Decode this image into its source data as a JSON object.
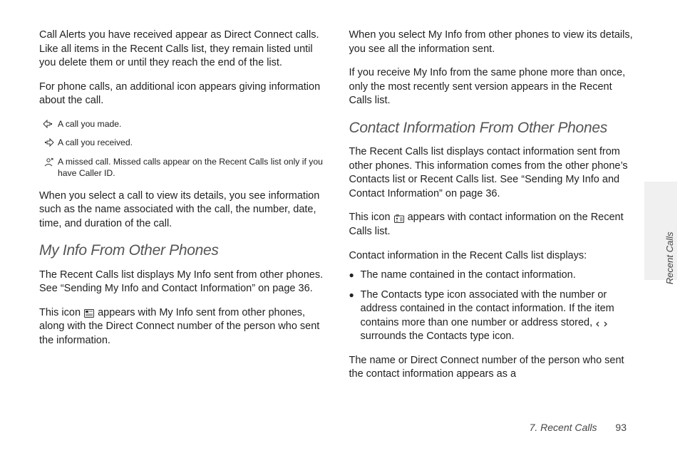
{
  "left": {
    "p1": "Call Alerts you have received appear as Direct Connect calls. Like all items in the Recent Calls list, they remain listed until you delete them or until they reach the end of the list.",
    "p2": "For phone calls, an additional icon appears giving information about the call.",
    "icons": [
      {
        "label": "A call you made."
      },
      {
        "label": "A call you received."
      },
      {
        "label": "A missed call. Missed calls appear on the Recent Calls list only if you have Caller ID."
      }
    ],
    "p3": "When you select a call to view its details, you see information such as the name associated with the call, the number, date, time, and duration of the call.",
    "h1": "My Info From Other Phones",
    "p4": "The Recent Calls list displays My Info sent from other phones. See “Sending My Info and Contact Information” on page 36.",
    "p5a": "This icon ",
    "p5b": " appears with My Info sent from other phones, along with the Direct Connect number of the person who sent the information."
  },
  "right": {
    "p1": "When you select My Info from other phones to view its details, you see all the information sent.",
    "p2": "If you receive My Info from the same phone more than once, only the most recently sent version appears in the Recent Calls list.",
    "h1": "Contact Information From Other Phones",
    "p3": "The Recent Calls list displays contact information sent from other phones. This information comes from the other phone’s Contacts list or Recent Calls list. See “Sending My Info and Contact Information” on page 36.",
    "p4a": "This icon ",
    "p4b": " appears with contact information on the Recent Calls list.",
    "p5": "Contact information in the Recent Calls list displays:",
    "b1": "The name contained in the contact information.",
    "b2a": "The Contacts type icon associated with the number or address contained in the contact information. If the item contains more than one number or address stored, ",
    "b2b": " surrounds the Contacts type icon.",
    "p6": "The name or Direct Connect number of the person who sent the contact information appears as a"
  },
  "footer": {
    "section": "7. Recent Calls",
    "page": "93"
  },
  "side": "Recent Calls"
}
